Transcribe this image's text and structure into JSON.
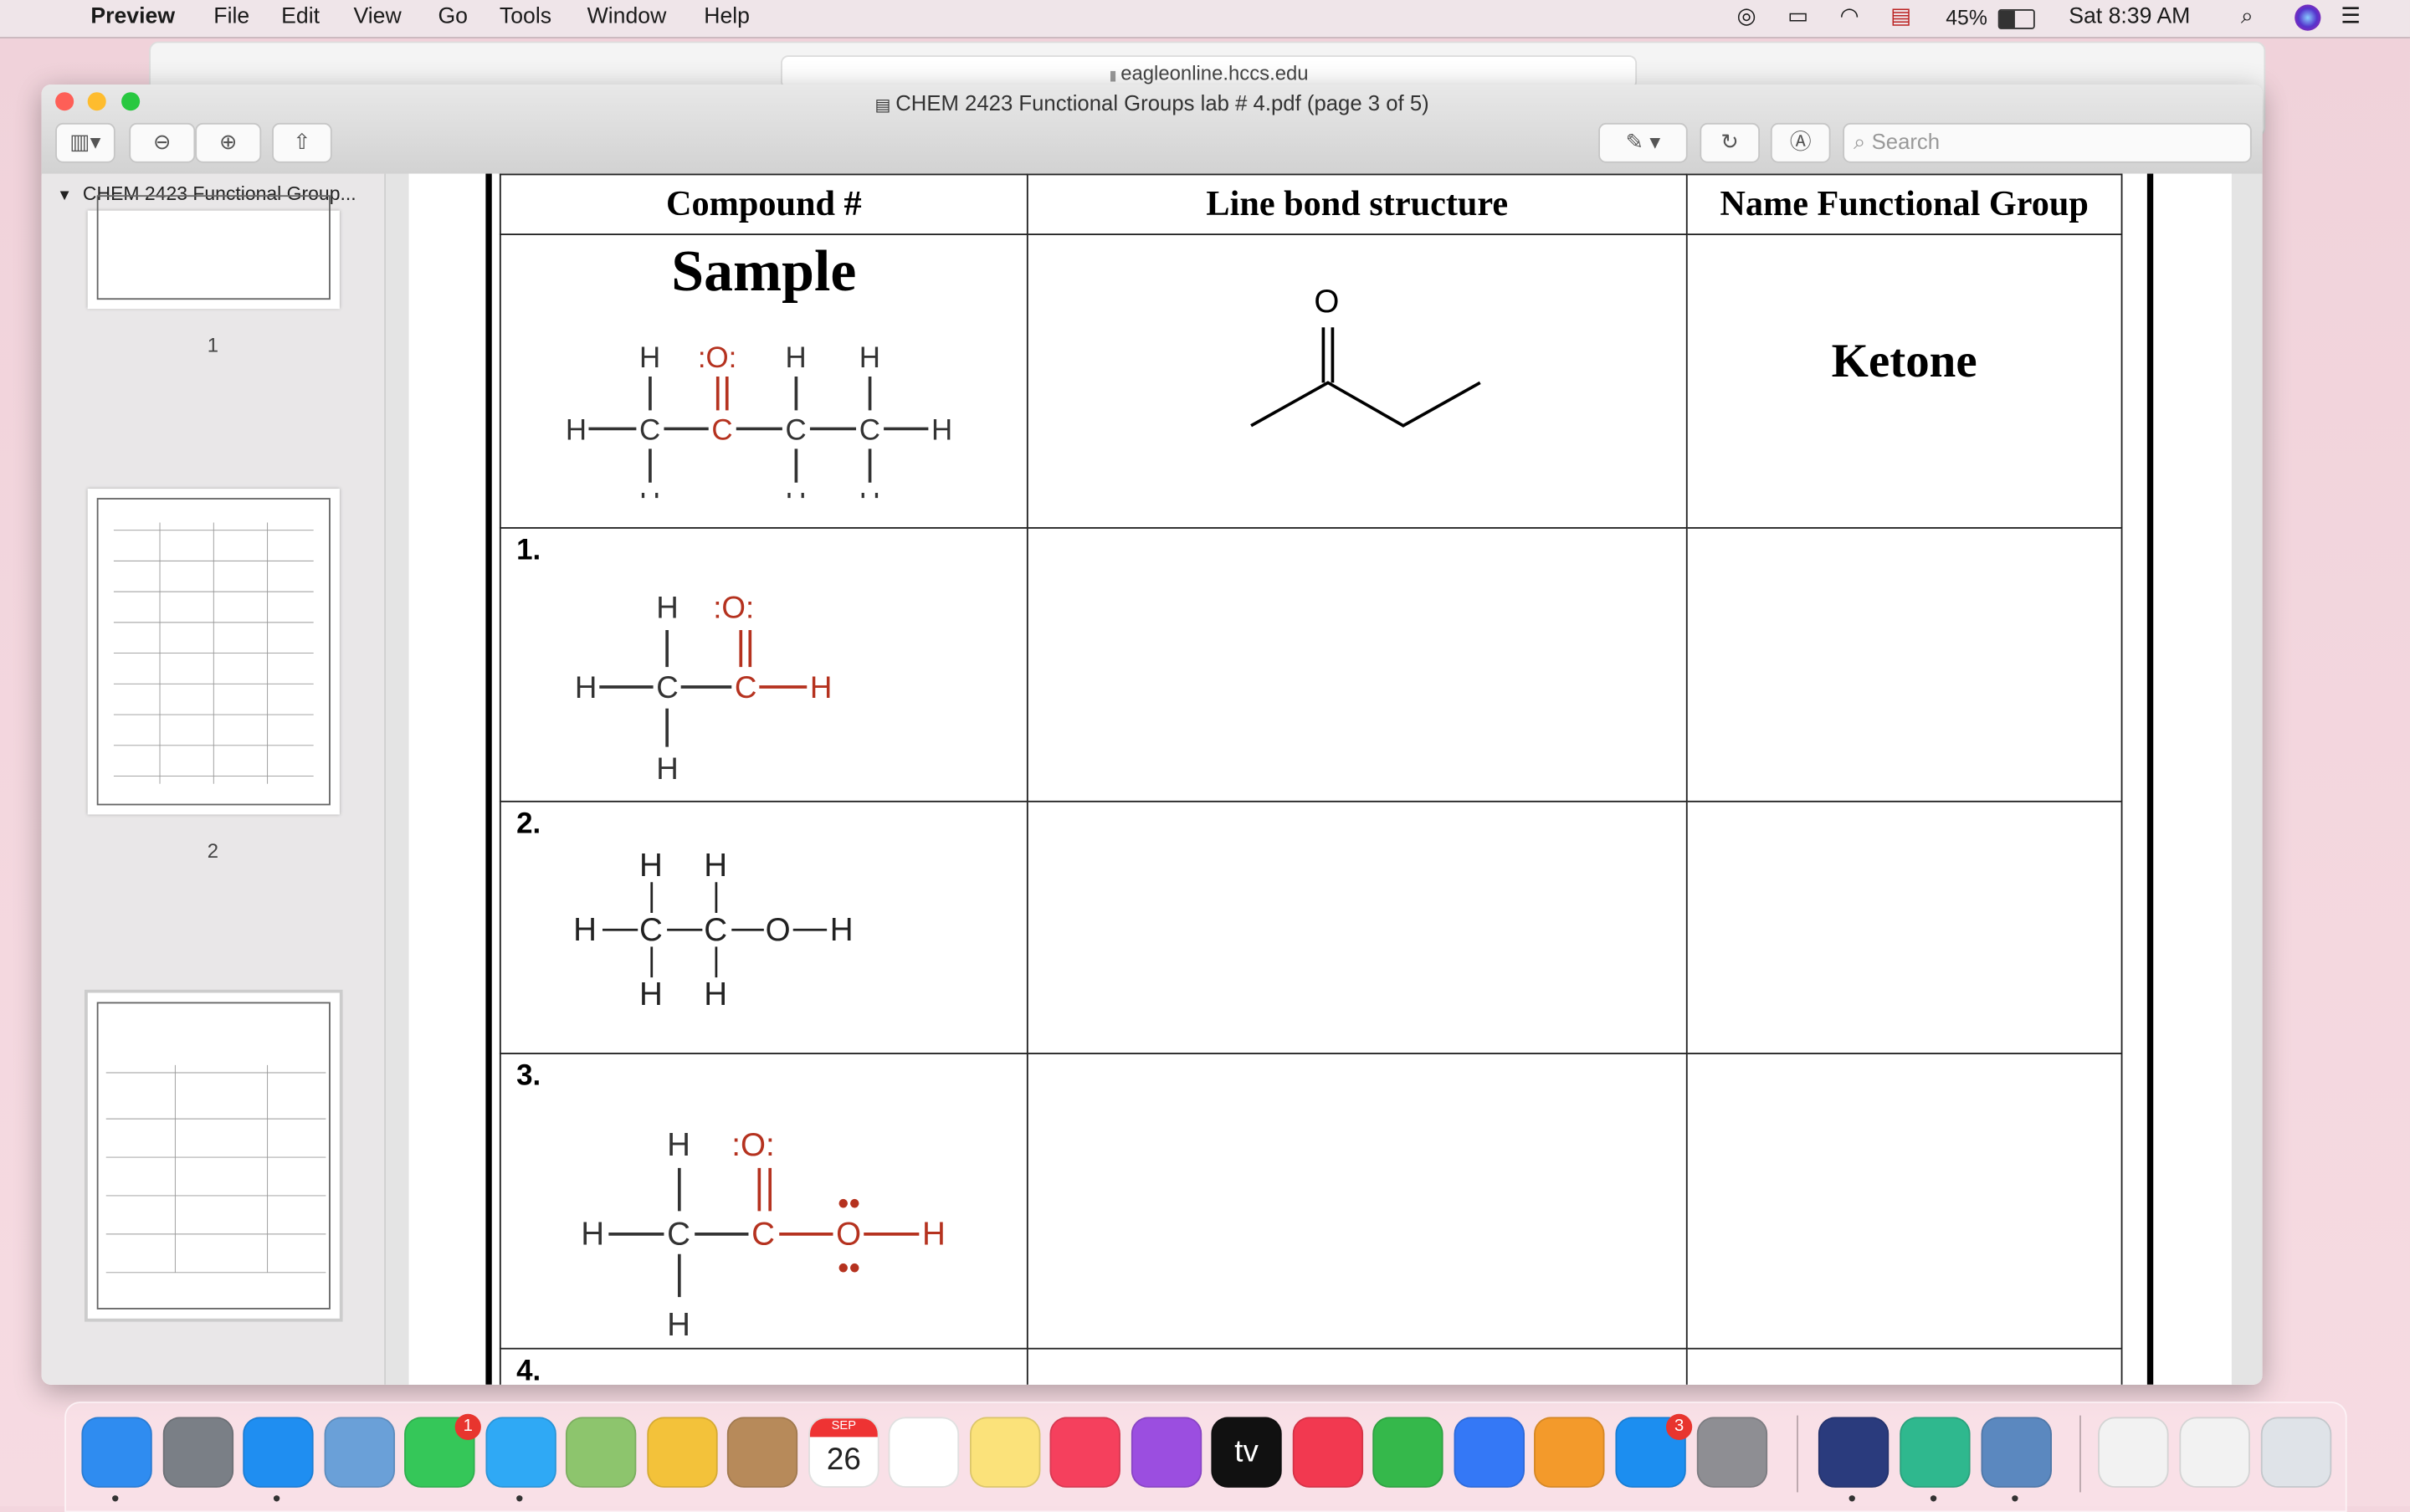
{
  "menubar": {
    "app": "Preview",
    "items": [
      "File",
      "Edit",
      "View",
      "Go",
      "Tools",
      "Window",
      "Help"
    ],
    "battery": "45%",
    "clock": "Sat 8:39 AM"
  },
  "safari": {
    "url": "eagleonline.hccs.edu"
  },
  "window": {
    "title": "CHEM 2423 Functional Groups lab # 4.pdf (page 3 of 5)",
    "search_placeholder": "Search"
  },
  "sidebar": {
    "doc_title": "CHEM 2423 Functional Group...",
    "pages": [
      "1",
      "2",
      "3"
    ],
    "current_page": "3"
  },
  "table": {
    "headers": [
      "Compound #",
      "Line bond structure",
      "Name Functional Group"
    ],
    "sample_label": "Sample",
    "sample_answer": "Ketone",
    "line_bond_atom": "O",
    "rows": [
      "1.",
      "2.",
      "3.",
      "4."
    ]
  },
  "dock": {
    "apps": [
      {
        "name": "finder",
        "color": "#2f8cf0"
      },
      {
        "name": "launchpad",
        "color": "#7a7f86"
      },
      {
        "name": "safari",
        "color": "#1f8ef1"
      },
      {
        "name": "preview",
        "color": "#6aa0d8"
      },
      {
        "name": "facetime",
        "color": "#35c759",
        "badge": "1"
      },
      {
        "name": "messages",
        "color": "#2fa9f5"
      },
      {
        "name": "maps",
        "color": "#8dc56d"
      },
      {
        "name": "photos",
        "color": "#f3c23a"
      },
      {
        "name": "contacts",
        "color": "#b78a5a"
      },
      {
        "name": "calendar",
        "color": "#ffffff",
        "text": "26",
        "month": "SEP"
      },
      {
        "name": "reminders",
        "color": "#ffffff"
      },
      {
        "name": "notes",
        "color": "#fbe27a"
      },
      {
        "name": "music",
        "color": "#f5405d"
      },
      {
        "name": "podcasts",
        "color": "#9b4ee0"
      },
      {
        "name": "tv",
        "color": "#111111",
        "text": "tv"
      },
      {
        "name": "news",
        "color": "#f23950"
      },
      {
        "name": "numbers",
        "color": "#35b84b"
      },
      {
        "name": "keynote",
        "color": "#3478f6"
      },
      {
        "name": "pages",
        "color": "#f39a2b"
      },
      {
        "name": "app-store",
        "color": "#1c8ef0",
        "badge": "3"
      },
      {
        "name": "system-preferences",
        "color": "#8e8e93"
      },
      {
        "name": "screenshot",
        "color": "#2a3b7d"
      },
      {
        "name": "edge",
        "color": "#2fb88e"
      },
      {
        "name": "image-capture",
        "color": "#5b88bf"
      },
      {
        "name": "document-1",
        "color": "#f2f2f2"
      },
      {
        "name": "document-2",
        "color": "#f2f2f2"
      },
      {
        "name": "trash",
        "color": "#dfe3e8"
      }
    ]
  }
}
